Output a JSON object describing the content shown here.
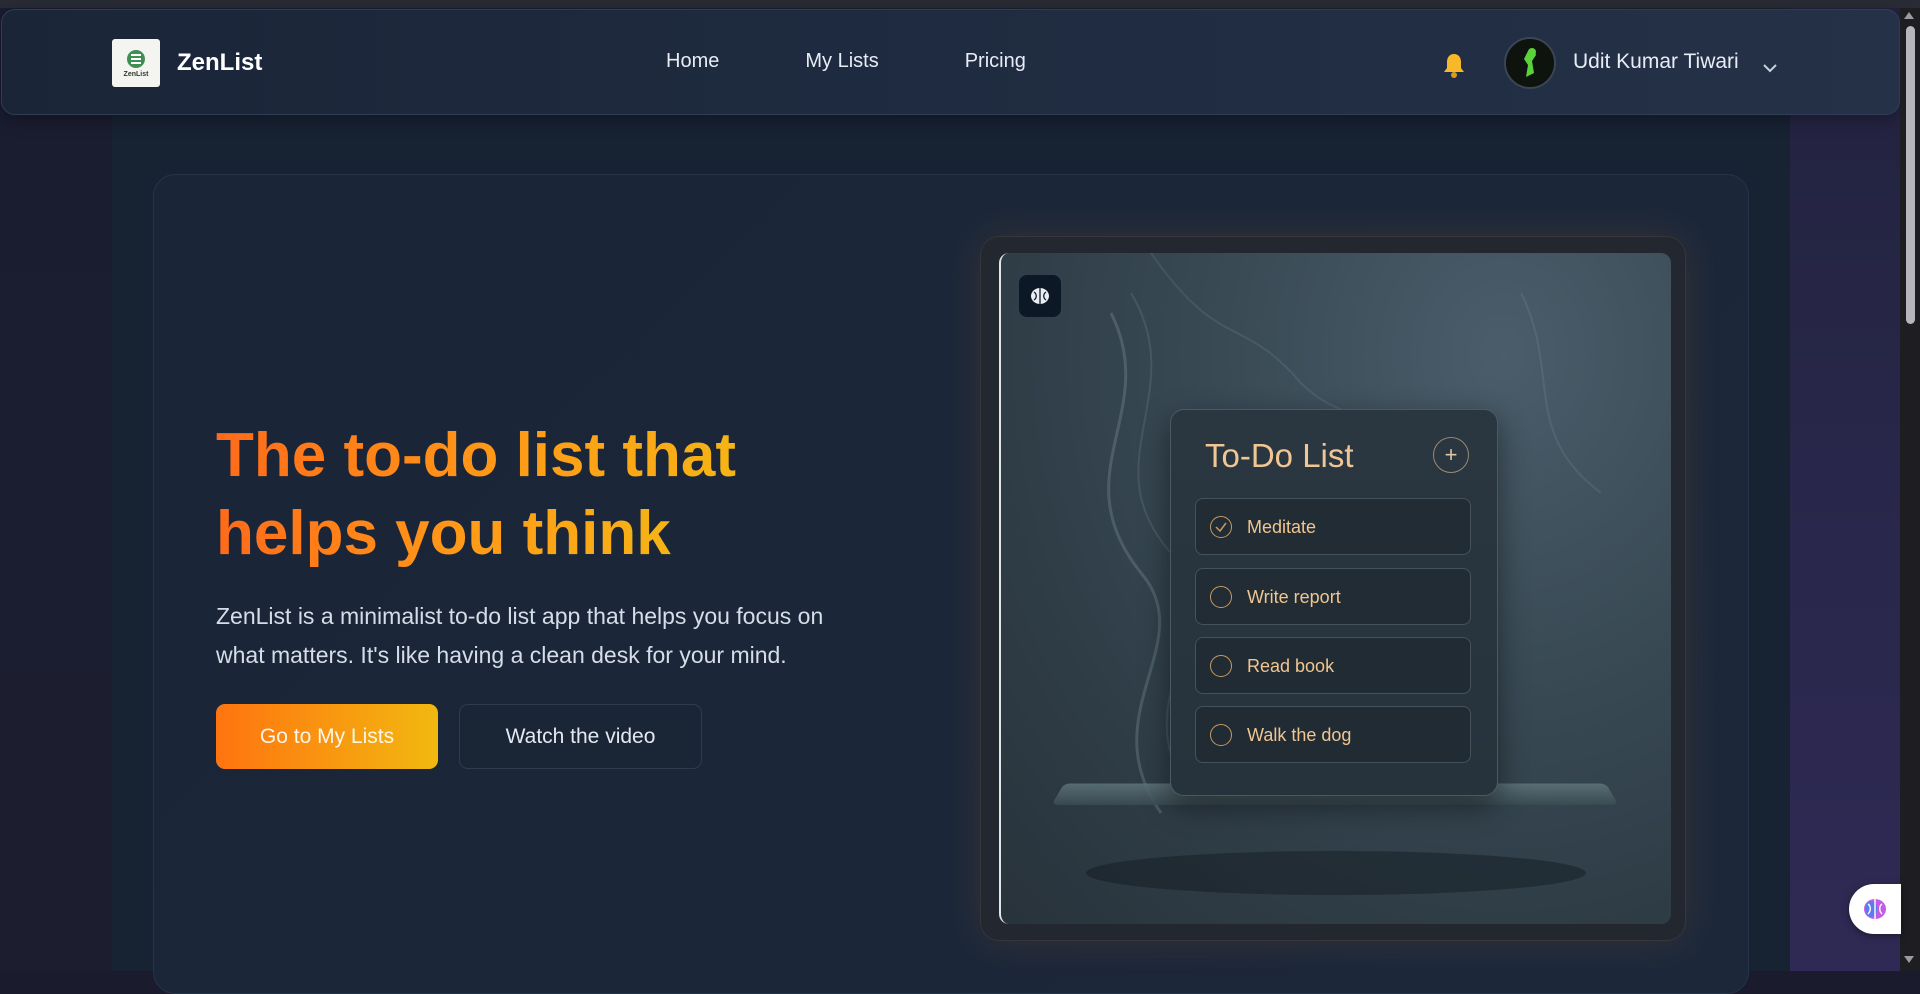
{
  "app": {
    "name": "ZenList",
    "logo_text": "ZenList"
  },
  "nav": {
    "links": [
      {
        "label": "Home"
      },
      {
        "label": "My Lists"
      },
      {
        "label": "Pricing"
      }
    ],
    "user_name": "Udit Kumar Tiwari",
    "icons": [
      "bell-icon",
      "chevron-down-icon"
    ]
  },
  "hero": {
    "headline_line1": "The to-do list that",
    "headline_line2": "helps you think",
    "description_line1": "ZenList is a minimalist to-do list app that helps you focus on",
    "description_line2": "what matters. It's like having a clean desk for your mind.",
    "primary_button": "Go to My Lists",
    "secondary_button": "Watch the video"
  },
  "preview": {
    "title": "To-Do List",
    "plus": "+",
    "items": [
      {
        "label": "Meditate",
        "checked": true
      },
      {
        "label": "Write report",
        "checked": false
      },
      {
        "label": "Read book",
        "checked": false
      },
      {
        "label": "Walk the dog",
        "checked": false
      }
    ]
  },
  "colors": {
    "accent_orange": "#ff7410",
    "accent_yellow": "#f2b810",
    "background": "#172233",
    "card": "#1a2638"
  }
}
